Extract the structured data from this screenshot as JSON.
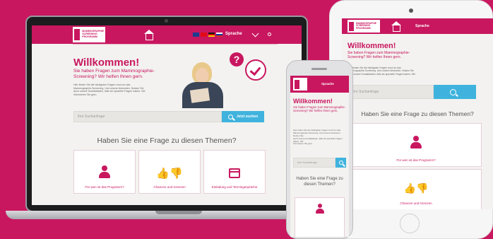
{
  "brand": {
    "logo_line1": "MAMMOGRAPHIE",
    "logo_line2": "SCREENING",
    "logo_line3": "PROGRAMM",
    "color_primary": "#c8175f",
    "color_accent": "#3fb3dd"
  },
  "header": {
    "language_label": "Sprache"
  },
  "hero": {
    "title": "Willkommen!",
    "subtitle_line1": "Sie haben Fragen zum Mammographie-",
    "subtitle_line2": "Screening? Wir helfen Ihnen gern.",
    "body_line1": "Hier finden Sie die häufigsten Fragen rund um das",
    "body_line2": "Mammographie-Screening. Und unsere Antworten. Nutzen Sie",
    "body_line3": "auch unsere Kontaktdaten, falls sie spezielle Fragen haben. Wir",
    "body_line4": "informieren Sie gern."
  },
  "search": {
    "placeholder": "Ihre Suchanfrage",
    "button_label": "Jetzt suchen"
  },
  "topics": {
    "title": "Haben Sie eine Frage zu diesen Themen?",
    "phone_title_line1": "Haben Sie eine Frage zu",
    "phone_title_line2": "diesen Themen?",
    "cards": [
      {
        "label": "Für wen ist das Programm?",
        "icon": "woman-icon"
      },
      {
        "label": "Chancen und Grenzen",
        "icon": "thumbs-icon"
      },
      {
        "label": "Einladung und Termingespräche",
        "icon": "calendar-icon"
      }
    ]
  }
}
